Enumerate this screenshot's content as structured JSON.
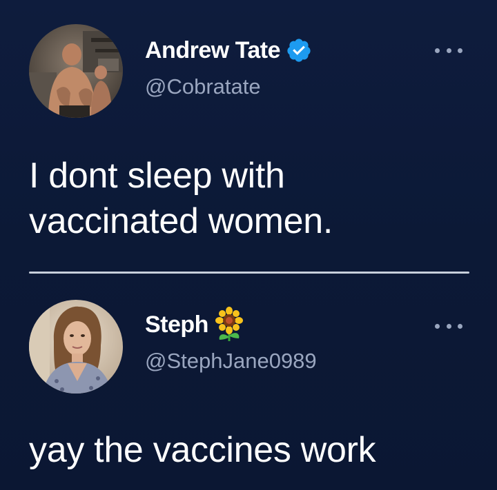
{
  "tweets": [
    {
      "display_name": "Andrew Tate",
      "handle": "@Cobratate",
      "text_lines": [
        "I dont sleep with",
        "vaccinated women."
      ],
      "badge_icon": "verified-icon",
      "more_icon": "more-options-icon"
    },
    {
      "display_name": "Steph",
      "handle": "@StephJane0989",
      "text_lines": [
        "yay the vaccines work"
      ],
      "badge_icon": "sunflower-icon",
      "more_icon": "more-options-icon"
    }
  ],
  "colors": {
    "background": "#0d1b3a",
    "text": "#ffffff",
    "handle": "#9aa6bf",
    "verified": "#1d9bf0",
    "divider": "#c8cfdb"
  }
}
